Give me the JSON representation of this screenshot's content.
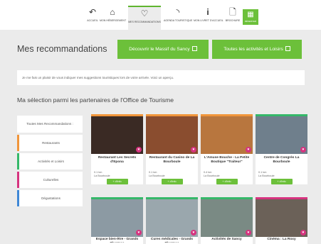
{
  "nav": [
    {
      "label": "Accueil",
      "icon": "back-arrow-icon"
    },
    {
      "label": "Mon hébergement",
      "icon": "home-icon"
    },
    {
      "label": "Mes recommandations",
      "icon": "heart-icon"
    },
    {
      "label": "Agenda touristique",
      "icon": "rss-icon"
    },
    {
      "label": "Mon livret d'accueil",
      "icon": "info-icon"
    },
    {
      "label": "Brochure",
      "icon": "pdf-icon"
    },
    {
      "label": "Réserver",
      "icon": "calendar-icon"
    }
  ],
  "header": {
    "title": "Mes recommandations",
    "btn_massif": "Découvrir le Massif du Sancy",
    "btn_activites": "Toutes les activités et Loisirs"
  },
  "intro": "Je me fais un plaisir de vous indiquer mes suggestions touristiques lors de votre arrivée. Voici un aperçu.",
  "section_title": "Ma sélection parmi les partenaires de l'Office de Tourisme",
  "filter": {
    "head": "Toutes Mes Recommandations :",
    "items": [
      "Restaurants",
      "Activités et Loisirs",
      "Culturelles",
      "Dégustations"
    ]
  },
  "cards": [
    {
      "title": "Restaurant Les Secrets d'Epona",
      "dist": "0.1 km",
      "loc": "La Bourboule",
      "btn": "+ d'info"
    },
    {
      "title": "Restaurant du Casino de La Bourboule",
      "dist": "0.1 km",
      "loc": "La Bourboule",
      "btn": "+ d'info"
    },
    {
      "title": "L'Amuse Bouche - La Petite Boutique \"Traiteur\"",
      "dist": "0.4 km",
      "loc": "La Bourboule",
      "btn": "+ d'info"
    },
    {
      "title": "Centre de Congrès La Bourboule",
      "dist": "0.1 km",
      "loc": "La Bourboule",
      "btn": "+ d'info"
    }
  ],
  "cards_row2": [
    {
      "title": "Espace bien-être - Grands Thermes"
    },
    {
      "title": "Cures médicales - Grands Thermes"
    },
    {
      "title": "Activités de Sancy"
    },
    {
      "title": "Cinéma : La Roxy"
    }
  ],
  "colors": {
    "green": "#6cc03a",
    "restaurants": "#f0953a",
    "activites": "#35b869",
    "culturelles": "#d6337f",
    "degustations": "#3f87d6"
  }
}
